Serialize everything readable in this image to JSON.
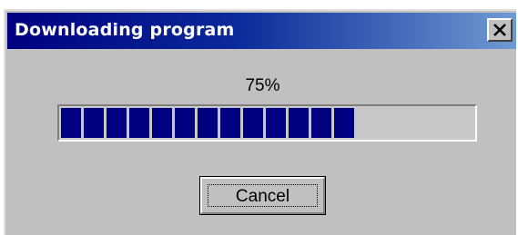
{
  "window": {
    "title": "Downloading program",
    "close_icon": "close-x-icon"
  },
  "progress": {
    "percent_text": "75%",
    "fraction": 0.75,
    "fill_color": "#000080"
  },
  "buttons": {
    "cancel_label": "Cancel"
  },
  "colors": {
    "dialog_face": "#c0c0c0",
    "titlebar_start": "#000080",
    "titlebar_end": "#6f9ad2",
    "title_text": "#ffffff"
  }
}
